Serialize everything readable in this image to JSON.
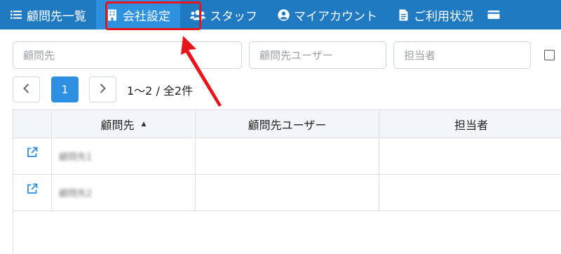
{
  "nav": {
    "items": [
      {
        "label": "顧問先一覧",
        "icon": "list-icon"
      },
      {
        "label": "会社設定",
        "icon": "building-icon"
      },
      {
        "label": "スタッフ",
        "icon": "users-icon"
      },
      {
        "label": "マイアカウント",
        "icon": "user-circle-icon"
      },
      {
        "label": "ご利用状況",
        "icon": "document-icon"
      }
    ],
    "active_index": 1
  },
  "filters": {
    "client_placeholder": "顧問先",
    "user_placeholder": "顧問先ユーザー",
    "staff_placeholder": "担当者"
  },
  "pagination": {
    "current_page": "1",
    "range_text": "1〜2 / 全2件"
  },
  "table": {
    "headers": {
      "client": "顧問先",
      "user": "顧問先ユーザー",
      "staff": "担当者"
    },
    "sort_indicator": "▲",
    "rows": [
      {
        "client": "顧問先1",
        "user": "",
        "staff": ""
      },
      {
        "client": "顧問先2",
        "user": "",
        "staff": ""
      }
    ]
  },
  "colors": {
    "navbar": "#1f7ac1",
    "nav_active": "#2e91e0",
    "highlight": "#e8141c",
    "primary": "#2c8fe0"
  }
}
